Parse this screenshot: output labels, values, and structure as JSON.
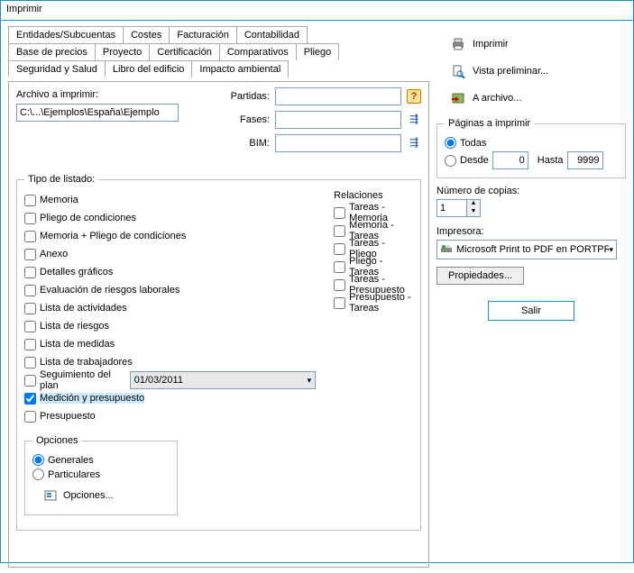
{
  "window": {
    "title": "Imprimir"
  },
  "tabs": {
    "row1": [
      "Entidades/Subcuentas",
      "Costes",
      "Facturación",
      "Contabilidad"
    ],
    "row2": [
      "Base de precios",
      "Proyecto",
      "Certificación",
      "Comparativos",
      "Pliego"
    ],
    "row3": [
      "Seguridad y Salud",
      "Libro del edificio",
      "Impacto ambiental"
    ],
    "active": "Seguridad y Salud"
  },
  "file": {
    "label": "Archivo a imprimir:",
    "path": "C:\\...\\Ejemplos\\España\\Ejemplo"
  },
  "fields": {
    "partidas": {
      "label": "Partidas:",
      "value": ""
    },
    "fases": {
      "label": "Fases:",
      "value": ""
    },
    "bim": {
      "label": "BIM:",
      "value": ""
    }
  },
  "tipo": {
    "legend": "Tipo de listado:",
    "items": [
      {
        "label": "Memoria",
        "checked": false
      },
      {
        "label": "Pliego de condiciones",
        "checked": false
      },
      {
        "label": "Memoria + Pliego de condiciones",
        "checked": false
      },
      {
        "label": "Anexo",
        "checked": false
      },
      {
        "label": "Detalles gráficos",
        "checked": false
      },
      {
        "label": "Evaluación de riesgos laborales",
        "checked": false
      },
      {
        "label": "Lista de actividades",
        "checked": false
      },
      {
        "label": "Lista de riesgos",
        "checked": false
      },
      {
        "label": "Lista de medidas",
        "checked": false
      },
      {
        "label": "Lista de trabajadores",
        "checked": false
      },
      {
        "label": "Seguimiento del plan",
        "checked": false,
        "date": "01/03/2011"
      },
      {
        "label": "Medición y presupuesto",
        "checked": true,
        "hl": true
      },
      {
        "label": "Presupuesto",
        "checked": false
      }
    ]
  },
  "relaciones": {
    "legend": "Relaciones",
    "items": [
      {
        "label": "Tareas - Memoria",
        "checked": false
      },
      {
        "label": "Memoria - Tareas",
        "checked": false
      },
      {
        "label": "Tareas - Pliego",
        "checked": false
      },
      {
        "label": "Pliego - Tareas",
        "checked": false
      },
      {
        "label": "Tareas - Presupuesto",
        "checked": false
      },
      {
        "label": "Presupuesto - Tareas",
        "checked": false
      }
    ]
  },
  "opciones": {
    "legend": "Opciones",
    "generales": "Generales",
    "particulares": "Particulares",
    "selected": "generales",
    "btn": "Opciones..."
  },
  "actions": {
    "print": "Imprimir",
    "preview": "Vista preliminar...",
    "tofile": "A archivo..."
  },
  "paginas": {
    "legend": "Páginas a imprimir",
    "todas": "Todas",
    "desde": "Desde",
    "hasta": "Hasta",
    "from": "0",
    "to": "9999",
    "selected": "todas"
  },
  "copias": {
    "label": "Número de copias:",
    "value": "1"
  },
  "impresora": {
    "label": "Impresora:",
    "value": "Microsoft Print to PDF en PORTPROMP"
  },
  "propiedades": "Propiedades...",
  "salir": "Salir"
}
